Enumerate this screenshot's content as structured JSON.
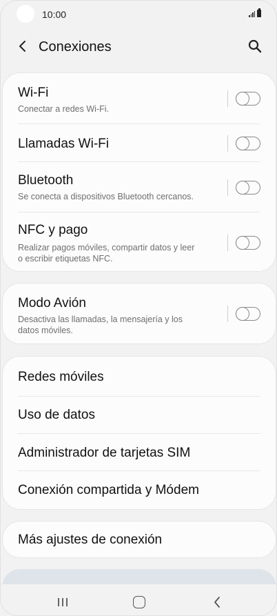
{
  "status": {
    "time": "10:00"
  },
  "header": {
    "title": "Conexiones"
  },
  "group1": [
    {
      "title": "Wi-Fi",
      "subtitle": "Conectar a redes Wi-Fi.",
      "toggle": "off"
    },
    {
      "title": "Llamadas Wi-Fi",
      "toggle": "off"
    },
    {
      "title": "Bluetooth",
      "subtitle": "Se conecta a dispositivos Bluetooth cercanos.",
      "toggle": "off"
    },
    {
      "title": "NFC y pago",
      "subtitle_line1": "Realizar pagos móviles, compartir datos y leer",
      "subtitle_line2": "o escribir etiquetas NFC.",
      "toggle": "off"
    }
  ],
  "group2": [
    {
      "title": "Modo Avión",
      "subtitle_line1": "Desactiva las llamadas, la mensajería y los",
      "subtitle_line2": "datos móviles.",
      "toggle": "off"
    }
  ],
  "group3": [
    {
      "title": "Redes móviles"
    },
    {
      "title": "Uso de datos"
    },
    {
      "title": "Administrador de tarjetas SIM"
    },
    {
      "title": "Conexión compartida y Módem"
    }
  ],
  "group4": [
    {
      "title": "Más ajustes de conexión"
    }
  ],
  "colors": {
    "background": "#f2f2f2",
    "card": "#fcfcfc",
    "subtitle": "#6e6e6e",
    "toggle_off": "#8a8a8a"
  }
}
